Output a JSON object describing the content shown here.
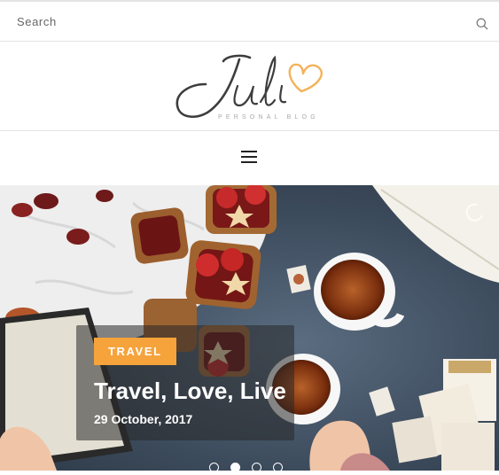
{
  "search": {
    "placeholder": "Search",
    "value": ""
  },
  "logo": {
    "text": "Juli",
    "tagline": "PERSONAL BLOG"
  },
  "nav": {
    "menu_icon": "hamburger-menu-icon"
  },
  "slider": {
    "category": "TRAVEL",
    "title": "Travel, Love, Live",
    "date": "29 October, 2017"
  },
  "colors": {
    "accent": "#f6a33c",
    "logo_text": "#3d3d3d",
    "heart": "#f3b25a",
    "border": "#e4e4e4"
  }
}
